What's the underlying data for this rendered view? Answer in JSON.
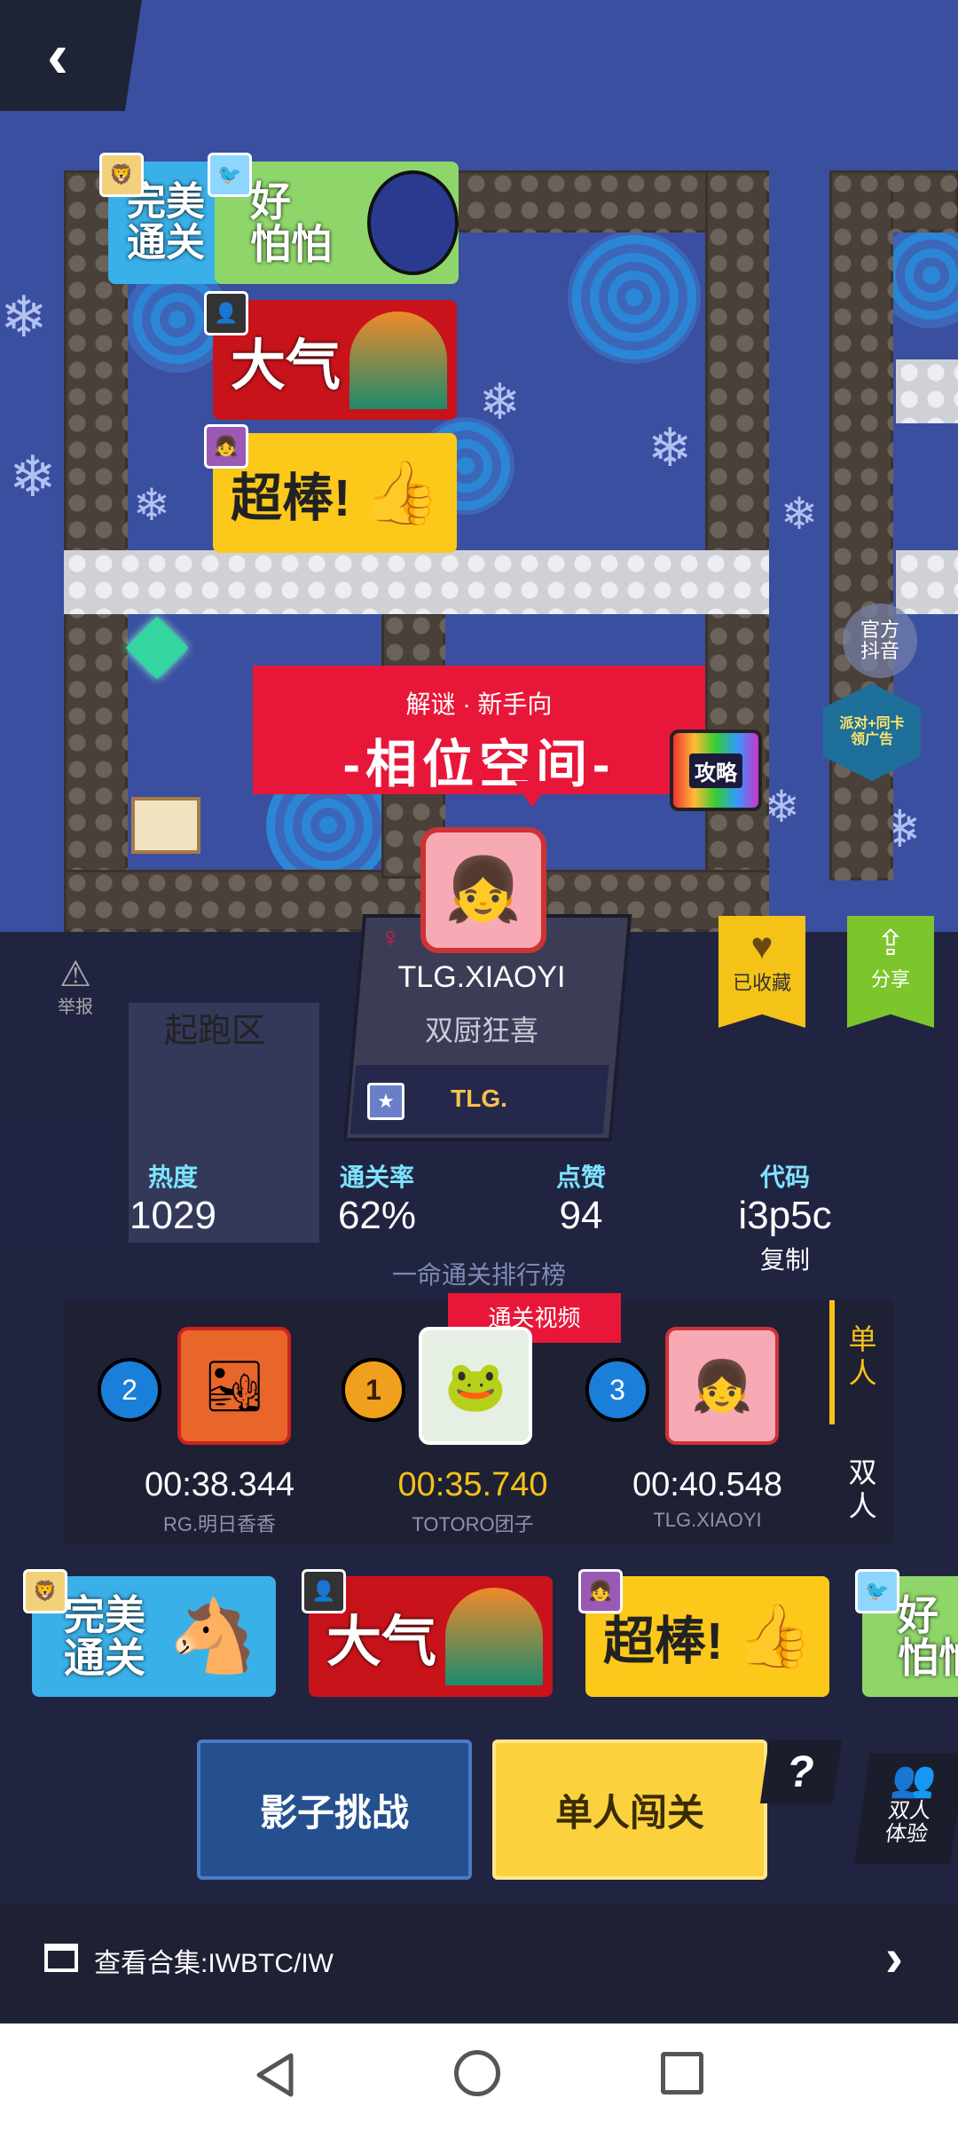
{
  "level": {
    "category": "解谜 · 新手向",
    "title": "-相位空间-",
    "guide_badge": "攻略",
    "start_zone": "起跑区"
  },
  "map_buttons": {
    "official_label": "官方\n抖音",
    "event_label": "派对+同卡\n领广告"
  },
  "creator": {
    "gender_icon": "female-icon",
    "name": "TLG.XIAOYI",
    "subtitle": "双厨狂喜",
    "team": "TLG."
  },
  "side_actions": {
    "favorite_label": "已收藏",
    "share_label": "分享",
    "report_label": "举报"
  },
  "stats": [
    {
      "label": "热度",
      "value": "1029"
    },
    {
      "label": "通关率",
      "value": "62%"
    },
    {
      "label": "点赞",
      "value": "94"
    },
    {
      "label": "代码",
      "value": "i3p5c"
    }
  ],
  "copy_label": "复制",
  "leaderboard": {
    "title": "一命通关排行榜",
    "video_label": "通关视频",
    "mode_single": "单\n人",
    "mode_double": "双\n人",
    "entries": [
      {
        "rank": "2",
        "time": "00:38.344",
        "name": "RG.明日香香"
      },
      {
        "rank": "1",
        "time": "00:35.740",
        "name": "TOTORO团子"
      },
      {
        "rank": "3",
        "time": "00:40.548",
        "name": "TLG.XIAOYI"
      }
    ]
  },
  "stickers_top": [
    {
      "label": "完美\n通关"
    },
    {
      "label": "好\n怕怕"
    },
    {
      "label": "大气"
    },
    {
      "label": "超棒!"
    }
  ],
  "stickers_bottom": [
    {
      "label": "完美\n通关"
    },
    {
      "label": "大气"
    },
    {
      "label": "超棒!"
    },
    {
      "label": "好\n怕怕"
    }
  ],
  "actions": {
    "shadow_challenge": "影子挑战",
    "solo_play": "单人闯关",
    "help": "?",
    "duo_label": "双人\n体验"
  },
  "collection": {
    "label": "查看合集:IWBTC/IW"
  },
  "colors": {
    "accent_yellow": "#f8d24a",
    "red": "#e8173a",
    "green": "#7cc52c",
    "dark_panel": "#1e2034"
  }
}
